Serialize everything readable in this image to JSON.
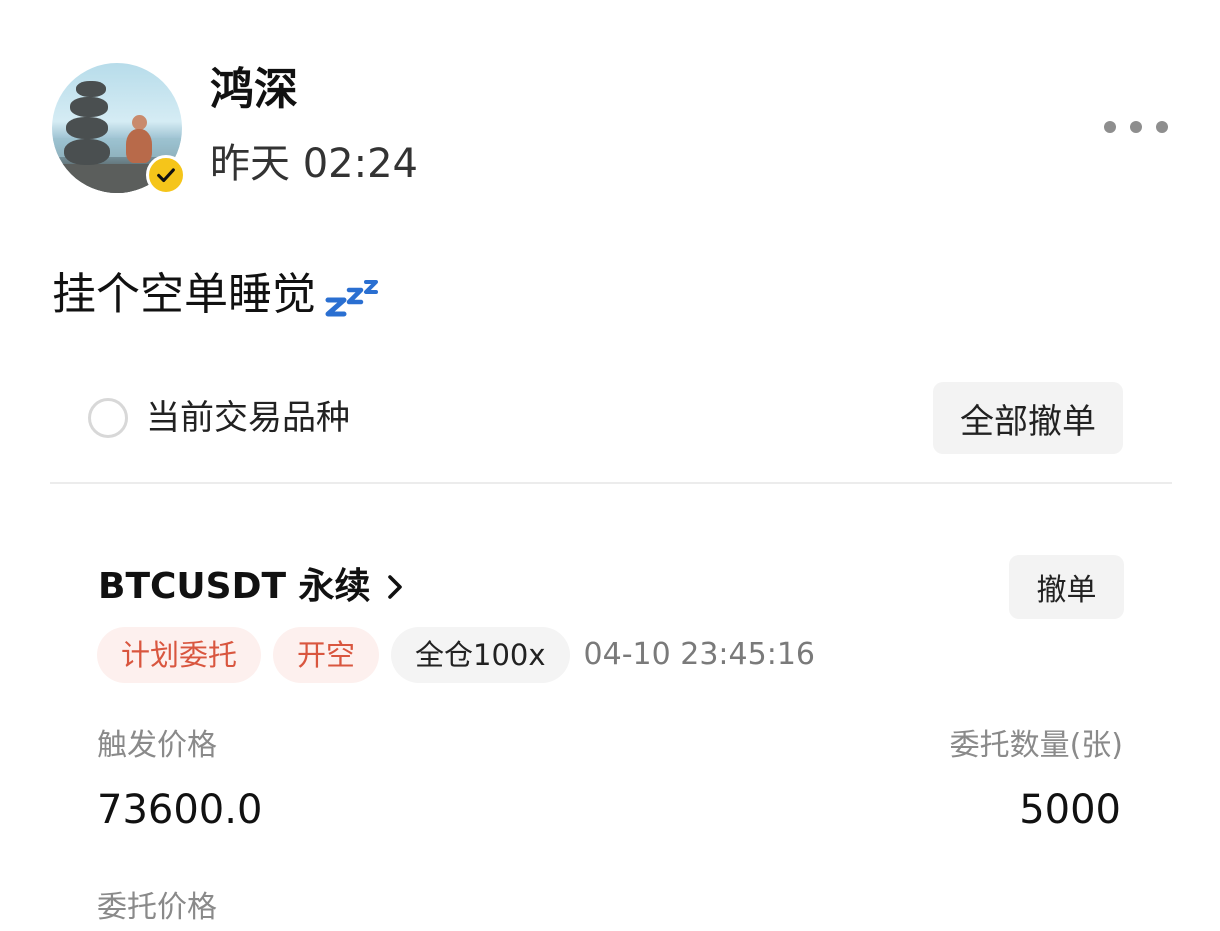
{
  "post": {
    "author": "鸿深",
    "time": "昨天 02:24",
    "text": "挂个空单睡觉",
    "emoji_icon": "zzz-icon"
  },
  "panel": {
    "filter_label": "当前交易品种",
    "cancel_all_label": "全部撤单"
  },
  "order": {
    "contract": "BTCUSDT 永续",
    "cancel_label": "撤单",
    "tags": [
      "计划委托",
      "开空",
      "全仓100x"
    ],
    "time": "04-10 23:45:16",
    "trigger_price_label": "触发价格",
    "trigger_price": "73600.0",
    "quantity_label": "委托数量(张)",
    "quantity": "5000",
    "order_price_label": "委托价格"
  },
  "colors": {
    "badge": "#f5c51a",
    "tag_red_text": "#d9563f",
    "tag_red_bg": "#fdf0ee",
    "zzz_blue": "#2a6fd1"
  }
}
